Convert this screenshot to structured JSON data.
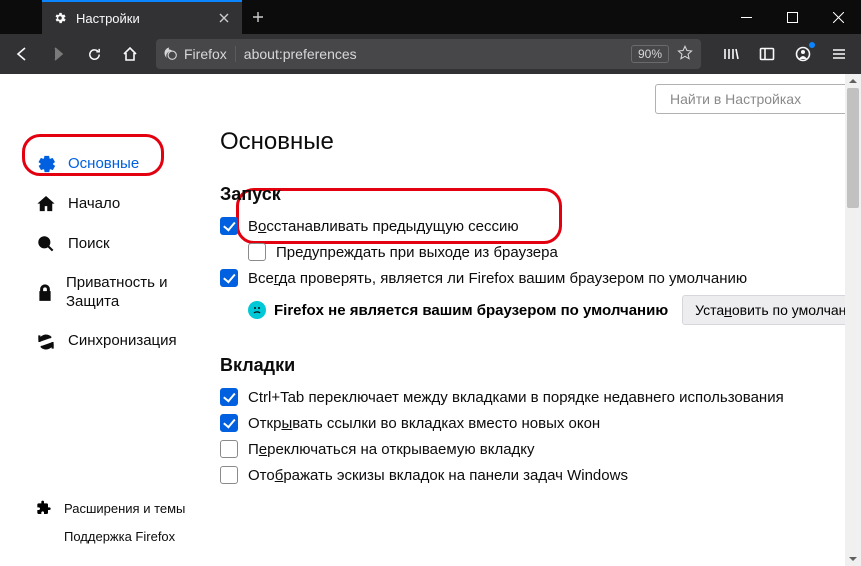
{
  "window": {
    "tab_title": "Настройки",
    "url_identity": "Firefox",
    "url": "about:preferences",
    "zoom": "90%"
  },
  "search": {
    "placeholder": "Найти в Настройках"
  },
  "sidebar": {
    "items": [
      {
        "label": "Основные"
      },
      {
        "label": "Начало"
      },
      {
        "label": "Поиск"
      },
      {
        "label": "Приватность и Защита"
      },
      {
        "label": "Синхронизация"
      }
    ],
    "footer": [
      {
        "label": "Расширения и темы"
      },
      {
        "label": "Поддержка Firefox"
      }
    ]
  },
  "page": {
    "title": "Основные",
    "startup": {
      "heading": "Запуск",
      "restore_pre": "В",
      "restore_u": "о",
      "restore_post": "сстанавливать предыдущую сессию",
      "warn": "Предупреждать при выходе из браузера",
      "always_pre": "Все",
      "always_u": "г",
      "always_post": "да проверять, является ли Firefox вашим браузером по умолчанию",
      "default_msg": "Firefox не является вашим браузером по умолчанию",
      "default_btn_pre": "Уста",
      "default_btn_u": "н",
      "default_btn_post": "овить по умолчан"
    },
    "tabs": {
      "heading": "Вкладки",
      "ctrl_tab": "Ctrl+Tab переключает между вкладками в порядке недавнего использования",
      "open_links_pre": "Откр",
      "open_links_u": "ы",
      "open_links_post": "вать ссылки во вкладках вместо новых окон",
      "switch_pre": "П",
      "switch_u": "е",
      "switch_post": "реключаться на открываемую вкладку",
      "taskbar_pre": "Ото",
      "taskbar_u": "б",
      "taskbar_post": "ражать эскизы вкладок на панели задач Windows"
    }
  }
}
